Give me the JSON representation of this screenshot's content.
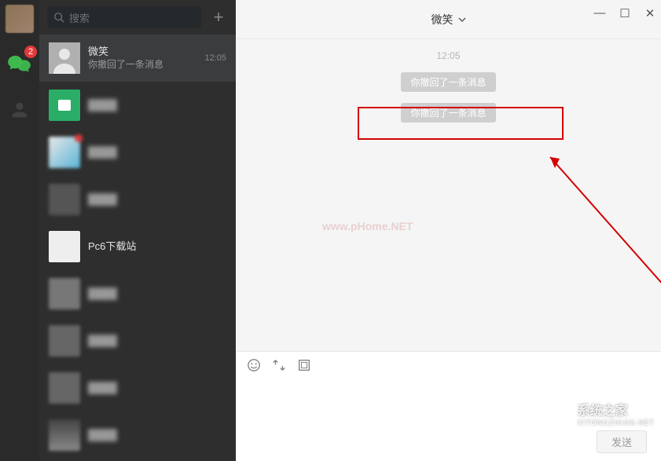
{
  "rail": {
    "badge": "2"
  },
  "search": {
    "placeholder": "搜索"
  },
  "conversations": [
    {
      "title": "微笑",
      "sub": "你撤回了一条消息",
      "time": "12:05"
    },
    {
      "title": "████",
      "sub": ""
    },
    {
      "title": "████",
      "sub": ""
    },
    {
      "title": "████",
      "sub": ""
    },
    {
      "title": "Pc6下载站",
      "sub": ""
    },
    {
      "title": "████",
      "sub": ""
    },
    {
      "title": "████",
      "sub": ""
    },
    {
      "title": "████",
      "sub": ""
    },
    {
      "title": "████",
      "sub": ""
    }
  ],
  "chat": {
    "title": "微笑",
    "timestamp": "12:05",
    "sys1": "你撤回了一条消息",
    "sys2": "你撤回了一条消息",
    "send": "发送"
  },
  "watermark": "www.pHome.NET",
  "sitemark": {
    "name": "系统之家",
    "sub": "XITONGZHIJIA.NET"
  }
}
